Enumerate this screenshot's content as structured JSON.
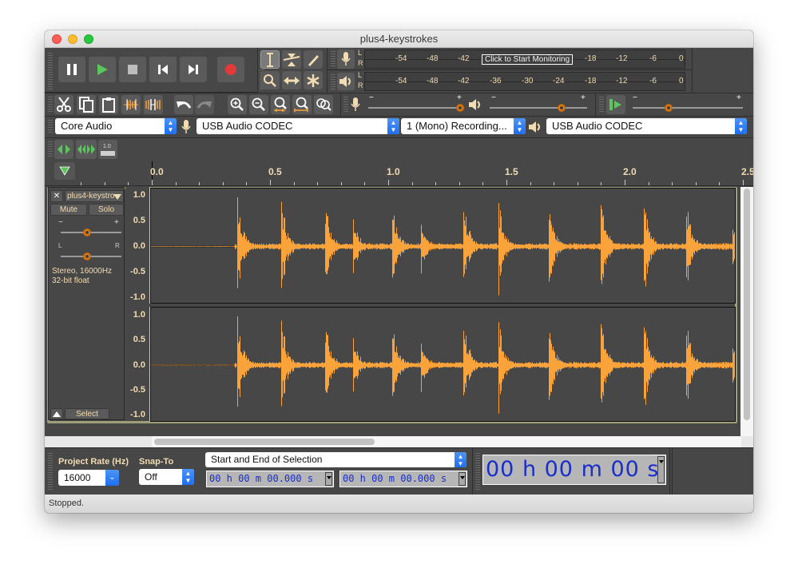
{
  "window": {
    "title": "plus4-keystrokes"
  },
  "transport": {
    "buttons": [
      {
        "name": "pause-button",
        "icon": "pause-icon"
      },
      {
        "name": "play-button",
        "icon": "play-icon"
      },
      {
        "name": "stop-button",
        "icon": "stop-icon"
      },
      {
        "name": "skip-to-start-button",
        "icon": "skip-start-icon"
      },
      {
        "name": "skip-to-end-button",
        "icon": "skip-end-icon"
      },
      {
        "name": "record-button",
        "icon": "record-icon"
      }
    ]
  },
  "tools": [
    "selection-tool",
    "envelope-tool",
    "draw-tool",
    "zoom-tool",
    "time-shift-tool",
    "multi-tool"
  ],
  "meters": {
    "record": {
      "channels": [
        "L",
        "R"
      ],
      "ticks": [
        "-54",
        "-48",
        "-42",
        "-18",
        "-12",
        "-6",
        "0"
      ],
      "overlay": "Click to Start Monitoring"
    },
    "playback": {
      "channels": [
        "L",
        "R"
      ],
      "ticks": [
        "-54",
        "-48",
        "-42",
        "-36",
        "-30",
        "-24",
        "-18",
        "-12",
        "-6",
        "0"
      ]
    }
  },
  "edit_toolbar": {
    "buttons": [
      "cut",
      "copy",
      "paste",
      "trim-audio",
      "silence-audio",
      "undo",
      "redo",
      "zoom-in",
      "zoom-out",
      "fit-selection",
      "fit-project",
      "zoom-toggle"
    ]
  },
  "mixer": {
    "record_volume": {
      "minus": "−",
      "plus": "+",
      "value": 1.0
    },
    "playback_volume": {
      "minus": "−",
      "plus": "+",
      "value": 0.8
    },
    "play_at_speed": {
      "minus": "−",
      "plus": "+",
      "value": 0.35
    }
  },
  "device": {
    "host": "Core Audio",
    "recording_device": "USB Audio CODEC",
    "recording_channels": "1 (Mono) Recording...",
    "playback_device": "USB Audio CODEC"
  },
  "ruler": {
    "labels": [
      "0.0",
      "0.5",
      "1.0",
      "1.5",
      "2.0",
      "2.5"
    ]
  },
  "track": {
    "close": "✕",
    "name": "plus4-keystro",
    "mute": "Mute",
    "solo": "Solo",
    "gain_minus": "−",
    "gain_plus": "+",
    "pan_left": "L",
    "pan_right": "R",
    "gain": 0.5,
    "pan": 0.5,
    "info_line1": "Stereo, 16000Hz",
    "info_line2": "32-bit float",
    "select": "Select",
    "vruler": [
      "1.0",
      "0.5",
      "0.0",
      "-0.5",
      "-1.0"
    ],
    "color": "#f9a33a"
  },
  "bottom": {
    "project_rate_label": "Project Rate (Hz)",
    "project_rate": "16000",
    "snap_label": "Snap-To",
    "snap_value": "Off",
    "selection_mode": "Start and End of Selection",
    "sel_start": "00 h 00 m 00.000 s",
    "sel_end": "00 h 00 m 00.000 s",
    "audio_position": "00 h 00 m 00 s"
  },
  "status": {
    "text": "Stopped."
  }
}
